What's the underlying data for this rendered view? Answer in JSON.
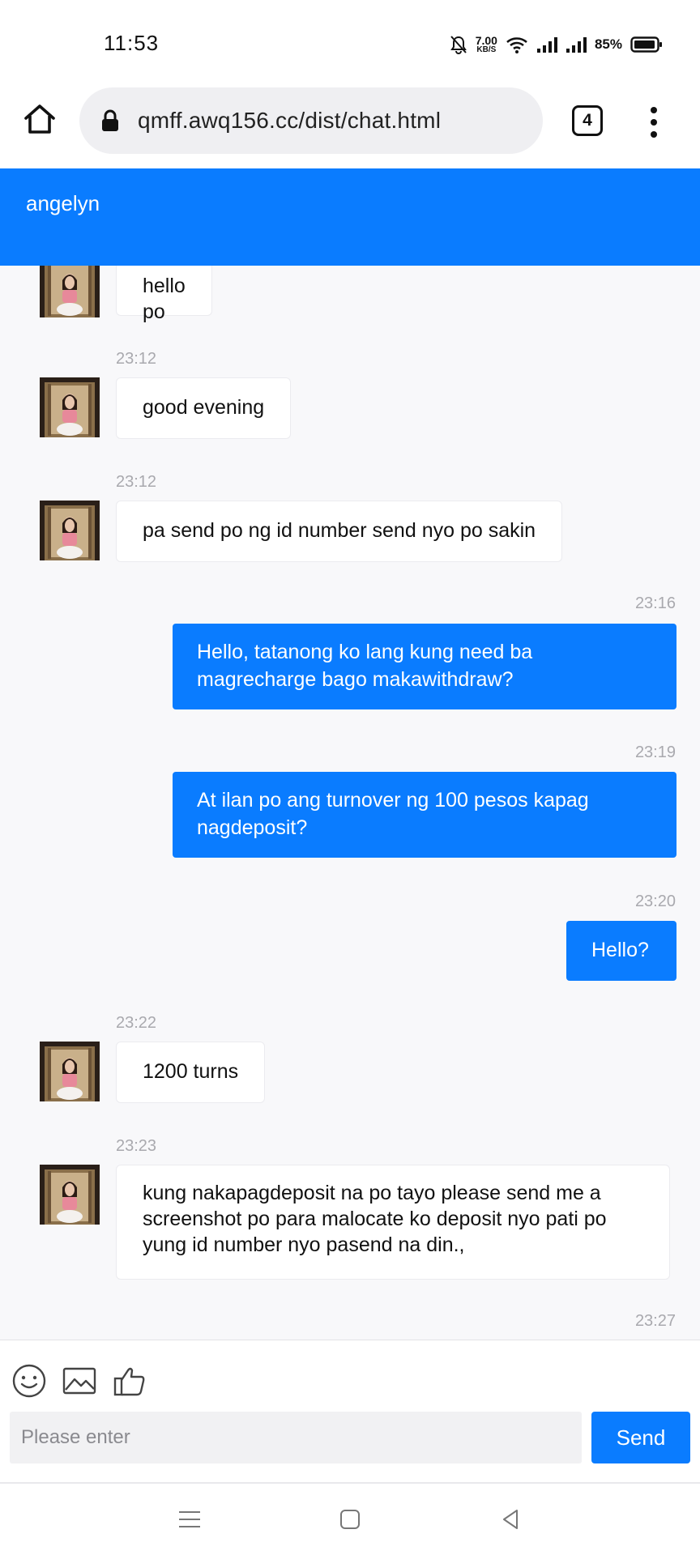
{
  "status": {
    "time": "11:53",
    "speed_value": "7.00",
    "speed_unit": "KB/S",
    "battery": "85%"
  },
  "browser": {
    "url": "qmff.awq156.cc/dist/chat.html",
    "tab_count": "4"
  },
  "chat": {
    "title": "angelyn"
  },
  "messages": [
    {
      "dir": "in",
      "time": "",
      "text": "hello po"
    },
    {
      "dir": "in",
      "time": "23:12",
      "text": "good evening"
    },
    {
      "dir": "in",
      "time": "23:12",
      "text": "pa send po ng id number send nyo po sakin"
    },
    {
      "dir": "out",
      "time": "23:16",
      "text": "Hello, tatanong ko lang kung need ba magrecharge bago makawithdraw?"
    },
    {
      "dir": "out",
      "time": "23:19",
      "text": "At ilan po ang turnover ng 100 pesos kapag nagdeposit?"
    },
    {
      "dir": "out",
      "time": "23:20",
      "text": "Hello?"
    },
    {
      "dir": "in",
      "time": "23:22",
      "text": "1200 turns"
    },
    {
      "dir": "in",
      "time": "23:23",
      "text": "kung nakapagdeposit na po tayo please send me a screenshot po para malocate ko deposit nyo pati po yung id number nyo pasend na din.,"
    },
    {
      "dir": "out",
      "time": "23:27",
      "text": ""
    }
  ],
  "composer": {
    "placeholder": "Please enter",
    "send_label": "Send"
  },
  "icons": {
    "home": "home-icon",
    "lock": "lock-icon",
    "menu": "more-vert-icon",
    "emoji": "emoji-icon",
    "image": "image-icon",
    "like": "thumbs-up-icon"
  },
  "colors": {
    "accent": "#0a7cff",
    "background": "#f8f8fa"
  }
}
